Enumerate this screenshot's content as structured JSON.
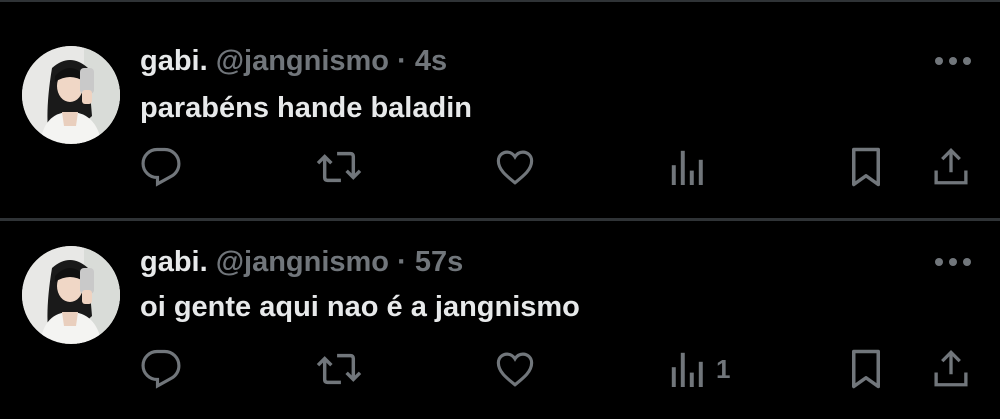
{
  "tweets": [
    {
      "display_name": "gabi.",
      "handle": "@jangnismo",
      "separator": "·",
      "time": "4s",
      "text": "parabéns hande baladin",
      "views_count": ""
    },
    {
      "display_name": "gabi.",
      "handle": "@jangnismo",
      "separator": "·",
      "time": "57s",
      "text": "oi gente aqui nao é a jangnismo",
      "views_count": "1"
    }
  ],
  "icons": {
    "reply": "reply-icon",
    "retweet": "retweet-icon",
    "like": "like-icon",
    "views": "views-icon",
    "bookmark": "bookmark-icon",
    "share": "share-icon",
    "more": "more-icon"
  },
  "colors": {
    "background": "#000000",
    "primary_text": "#e7e9ea",
    "secondary_text": "#71767b",
    "divider": "#2f3336"
  }
}
